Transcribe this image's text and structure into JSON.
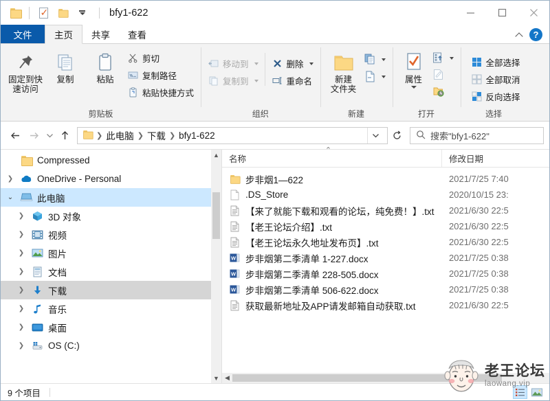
{
  "window": {
    "title": "bfy1-622",
    "quick_access": [
      {
        "name": "folder-icon",
        "label": "属性"
      },
      {
        "name": "properties-icon",
        "label": "属性"
      },
      {
        "name": "new-folder-icon",
        "label": "新建文件夹"
      },
      {
        "name": "customize-caret-icon",
        "label": "自定义快速访问工具栏"
      }
    ],
    "controls": {
      "minimize": "最小化",
      "maximize": "最大化",
      "close": "关闭"
    }
  },
  "tabs": [
    {
      "label": "文件",
      "type": "file"
    },
    {
      "label": "主页",
      "type": "active"
    },
    {
      "label": "共享",
      "type": "normal"
    },
    {
      "label": "查看",
      "type": "normal"
    }
  ],
  "tab_right": {
    "collapse": "折叠功能区",
    "help": "?"
  },
  "ribbon": {
    "groups": [
      {
        "label": "剪贴板",
        "big_buttons": [
          {
            "label": "固定到快\n速访问",
            "icon": "pin-icon"
          },
          {
            "label": "复制",
            "icon": "copy-icon"
          },
          {
            "label": "粘贴",
            "icon": "paste-icon"
          }
        ],
        "small_buttons": [
          {
            "label": "剪切",
            "icon": "scissors-icon",
            "dim": false
          },
          {
            "label": "复制路径",
            "icon": "copy-path-icon",
            "dim": false
          },
          {
            "label": "粘贴快捷方式",
            "icon": "paste-shortcut-icon",
            "dim": false
          }
        ]
      },
      {
        "label": "组织",
        "small_buttons": [
          {
            "label": "移动到",
            "icon": "move-to-icon",
            "dim": true,
            "caret": true
          },
          {
            "label": "复制到",
            "icon": "copy-to-icon",
            "dim": true,
            "caret": true
          }
        ],
        "small_buttons2": [
          {
            "label": "删除",
            "icon": "delete-x-icon",
            "dim": false,
            "caret": true
          },
          {
            "label": "重命名",
            "icon": "rename-icon",
            "dim": false,
            "caret": false
          }
        ]
      },
      {
        "label": "新建",
        "big_buttons": [
          {
            "label": "新建\n文件夹",
            "icon": "new-folder-big-icon"
          }
        ],
        "small_buttons": [
          {
            "label": "",
            "icon": "new-item-icon",
            "caret": true
          },
          {
            "label": "",
            "icon": "easy-access-icon",
            "caret": true
          }
        ]
      },
      {
        "label": "打开",
        "big_buttons": [
          {
            "label": "属性",
            "icon": "properties-big-icon",
            "caret": true
          }
        ],
        "small_buttons": [
          {
            "label": "",
            "icon": "open-with-icon",
            "caret": true
          },
          {
            "label": "",
            "icon": "edit-icon",
            "caret": false
          },
          {
            "label": "",
            "icon": "history-icon",
            "caret": false
          }
        ]
      },
      {
        "label": "选择",
        "small_buttons": [
          {
            "label": "全部选择",
            "icon": "select-all-icon"
          },
          {
            "label": "全部取消",
            "icon": "select-none-icon"
          },
          {
            "label": "反向选择",
            "icon": "invert-selection-icon"
          }
        ]
      }
    ]
  },
  "address": {
    "back": "后退",
    "forward": "前进",
    "recent": "最近位置",
    "up": "上移到",
    "crumbs": [
      "此电脑",
      "下载",
      "bfy1-622"
    ],
    "dropdown": "历史记录",
    "refresh": "刷新",
    "search_placeholder": "搜索\"bfy1-622\""
  },
  "nav_tree": [
    {
      "label": "Compressed",
      "icon": "folder-icon",
      "indent": 2,
      "chevron": "none",
      "state": "none"
    },
    {
      "label": "OneDrive - Personal",
      "icon": "onedrive-icon",
      "indent": 1,
      "chevron": "collapsed",
      "state": "none"
    },
    {
      "label": "此电脑",
      "icon": "this-pc-icon",
      "indent": 1,
      "chevron": "expanded",
      "state": "selected-blue"
    },
    {
      "label": "3D 对象",
      "icon": "3d-objects-icon",
      "indent": 2,
      "chevron": "collapsed",
      "state": "none"
    },
    {
      "label": "视频",
      "icon": "videos-icon",
      "indent": 2,
      "chevron": "collapsed",
      "state": "none"
    },
    {
      "label": "图片",
      "icon": "pictures-icon",
      "indent": 2,
      "chevron": "collapsed",
      "state": "none"
    },
    {
      "label": "文档",
      "icon": "documents-icon",
      "indent": 2,
      "chevron": "collapsed",
      "state": "none"
    },
    {
      "label": "下载",
      "icon": "downloads-icon",
      "indent": 2,
      "chevron": "collapsed",
      "state": "selected-gray"
    },
    {
      "label": "音乐",
      "icon": "music-icon",
      "indent": 2,
      "chevron": "collapsed",
      "state": "none"
    },
    {
      "label": "桌面",
      "icon": "desktop-icon",
      "indent": 2,
      "chevron": "collapsed",
      "state": "none"
    },
    {
      "label": "OS (C:)",
      "icon": "drive-icon",
      "indent": 2,
      "chevron": "collapsed",
      "state": "none"
    }
  ],
  "columns": [
    {
      "label": "名称",
      "key": "name"
    },
    {
      "label": "修改日期",
      "key": "date"
    }
  ],
  "files": [
    {
      "name": "步非烟1—622",
      "date": "2021/7/25 7:40",
      "icon": "folder-icon"
    },
    {
      "name": ".DS_Store",
      "date": "2020/10/15 23:",
      "icon": "blank-file-icon"
    },
    {
      "name": "【来了就能下载和观看的论坛，纯免费！】.txt",
      "date": "2021/6/30 22:5",
      "icon": "text-file-icon"
    },
    {
      "name": "【老王论坛介绍】.txt",
      "date": "2021/6/30 22:5",
      "icon": "text-file-icon"
    },
    {
      "name": "【老王论坛永久地址发布页】.txt",
      "date": "2021/6/30 22:5",
      "icon": "text-file-icon"
    },
    {
      "name": "步非烟第二季清单    1-227.docx",
      "date": "2021/7/25 0:38",
      "icon": "word-file-icon"
    },
    {
      "name": "步非烟第二季清单 228-505.docx",
      "date": "2021/7/25 0:38",
      "icon": "word-file-icon"
    },
    {
      "name": "步非烟第二季清单 506-622.docx",
      "date": "2021/7/25 0:38",
      "icon": "word-file-icon"
    },
    {
      "name": "获取最新地址及APP请发邮箱自动获取.txt",
      "date": "2021/6/30 22:5",
      "icon": "text-file-icon"
    }
  ],
  "status": {
    "item_count": "9 个项目"
  },
  "view_modes": [
    {
      "name": "details-view",
      "active": true
    },
    {
      "name": "large-icons-view",
      "active": false
    }
  ],
  "watermark": {
    "title": "老王论坛",
    "subtitle": "laowang.vip"
  },
  "colors": {
    "accent": "#0a5aaa",
    "selection": "#cce8ff",
    "folder": "#fcd884",
    "word": "#2b579a",
    "help": "#1476c8"
  }
}
